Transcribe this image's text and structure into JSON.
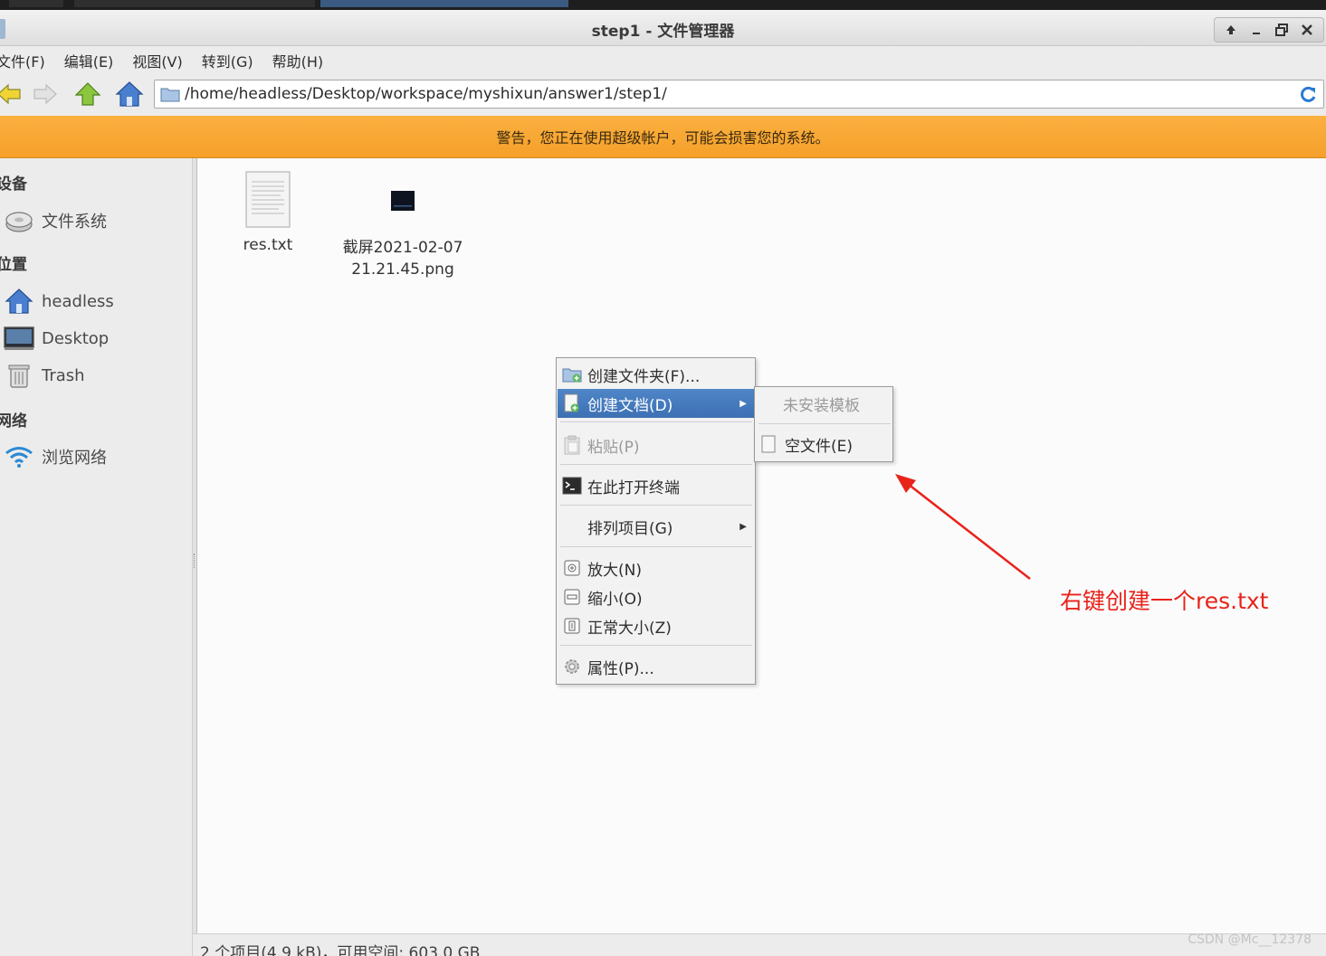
{
  "window": {
    "title": "step1 - 文件管理器",
    "controls": [
      "up-icon",
      "minimize-icon",
      "maximize-icon",
      "close-icon"
    ]
  },
  "menubar": {
    "items": [
      {
        "label": "文件(F)"
      },
      {
        "label": "编辑(E)"
      },
      {
        "label": "视图(V)"
      },
      {
        "label": "转到(G)"
      },
      {
        "label": "帮助(H)"
      }
    ]
  },
  "toolbar": {
    "buttons": [
      "back-arrow-icon",
      "forward-arrow-icon",
      "parent-folder-icon",
      "home-icon"
    ],
    "address": "/home/headless/Desktop/workspace/myshixun/answer1/step1/"
  },
  "warning": {
    "text": "警告，您正在使用超级帐户，可能会损害您的系统。",
    "color": "#f7a633"
  },
  "sidebar": {
    "sections": [
      {
        "title": "设备",
        "items": [
          {
            "label": "文件系统",
            "icon": "drive-icon"
          }
        ]
      },
      {
        "title": "位置",
        "items": [
          {
            "label": "headless",
            "icon": "home-icon"
          },
          {
            "label": "Desktop",
            "icon": "desktop-icon"
          },
          {
            "label": "Trash",
            "icon": "trash-icon"
          }
        ]
      },
      {
        "title": "网络",
        "items": [
          {
            "label": "浏览网络",
            "icon": "wifi-icon"
          }
        ]
      }
    ]
  },
  "files": [
    {
      "name": "res.txt",
      "icon": "text-file-icon"
    },
    {
      "name_line1": "截屏2021-02-07",
      "name_line2": "21.21.45.png",
      "icon": "image-file-icon"
    }
  ],
  "context_menu": {
    "items": [
      {
        "label": "创建文件夹(F)...",
        "icon": "new-folder-icon"
      },
      {
        "label": "创建文档(D)",
        "icon": "new-document-icon",
        "submenu": true,
        "highlighted": true
      },
      {
        "label": "粘贴(P)",
        "icon": "paste-icon",
        "disabled": true
      },
      {
        "label": "在此打开终端",
        "icon": "terminal-icon"
      },
      {
        "label": "排列项目(G)",
        "submenu": true
      },
      {
        "label": "放大(N)",
        "icon": "zoom-in-icon"
      },
      {
        "label": "缩小(O)",
        "icon": "zoom-out-icon"
      },
      {
        "label": "正常大小(Z)",
        "icon": "zoom-normal-icon"
      },
      {
        "label": "属性(P)...",
        "icon": "properties-icon"
      }
    ],
    "highlight_color": "#4479bd"
  },
  "submenu": {
    "items": [
      {
        "label": "未安装模板",
        "disabled": true
      },
      {
        "label": "空文件(E)",
        "icon": "empty-file-icon"
      }
    ]
  },
  "annotation": {
    "text": "右键创建一个res.txt",
    "color": "#e8231b"
  },
  "statusbar": {
    "text": "2 个项目(4.9 kB)，可用空间: 603.0 GB"
  },
  "watermark": "CSDN @Mc__12378"
}
